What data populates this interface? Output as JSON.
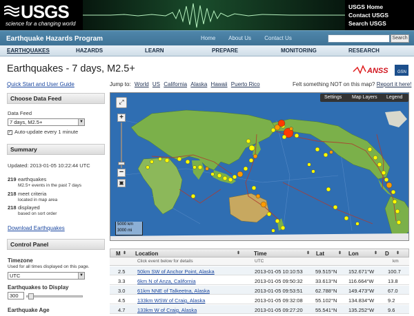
{
  "header": {
    "logo_text": "USGS",
    "logo_tagline": "science for a changing world",
    "links": [
      "USGS Home",
      "Contact USGS",
      "Search USGS"
    ]
  },
  "subheader": {
    "program": "Earthquake Hazards Program",
    "links": [
      "Home",
      "About Us",
      "Contact Us"
    ],
    "search_button": "Search"
  },
  "nav": [
    "EARTHQUAKES",
    "HAZARDS",
    "LEARN",
    "PREPARE",
    "MONITORING",
    "RESEARCH"
  ],
  "page": {
    "title": "Earthquakes - 7 days, M2.5+",
    "anss_logo": "ANSS",
    "anss_sublabel": "GSN"
  },
  "sidebar": {
    "quickstart": "Quick Start and User Guide",
    "choose_feed": {
      "heading": "Choose Data Feed",
      "label": "Data Feed",
      "selected": "7 days, M2.5+",
      "auto_update": "Auto-update every 1 minute",
      "auto_update_checked": true
    },
    "summary": {
      "heading": "Summary",
      "updated": "Updated: 2013-01-05 10:22:44 UTC",
      "count_earthquakes": "219",
      "earthquakes_label": "earthquakes",
      "earthquakes_desc": "M2.5+ events in the past 7 days",
      "count_meet": "218",
      "meet_label": "meet criteria",
      "meet_desc": "located in map area",
      "count_displayed": "218",
      "displayed_label": "displayed",
      "displayed_desc": "based on sort order",
      "download": "Download Earthquakes"
    },
    "control": {
      "heading": "Control Panel",
      "timezone_label": "Timezone",
      "timezone_desc": "Used for all times displayed on this page.",
      "timezone_selected": "UTC",
      "display_label": "Earthquakes to Display",
      "display_value": "300",
      "age_label": "Earthquake Age"
    }
  },
  "jump": {
    "label": "Jump to:",
    "links": [
      "World",
      "US",
      "California",
      "Alaska",
      "Hawaii",
      "Puerto Rico"
    ]
  },
  "felt": {
    "text": "Felt something NOT on this map?",
    "link": "Report it here!"
  },
  "map": {
    "controls": [
      "Settings",
      "Map Layers",
      "Legend"
    ],
    "scale_km": "5000 km",
    "scale_mi": "3000 mi",
    "colors": {
      "ocean": "#2f6eb2",
      "land": "#7bb04a",
      "quake_recent": "#ff3b00",
      "quake_day": "#ff9a00",
      "quake_week": "#ffff00"
    }
  },
  "table": {
    "columns": [
      "M",
      "Location",
      "Time",
      "Lat",
      "Lon",
      "D"
    ],
    "subheaders": [
      "Click event below for details",
      "UTC",
      "",
      "",
      "km"
    ],
    "rows": [
      {
        "m": "2.5",
        "location": "50km SW of Anchor Point, Alaska",
        "time": "2013-01-05 10:10:53",
        "lat": "59.515°N",
        "lon": "152.671°W",
        "depth": "100.7"
      },
      {
        "m": "3.3",
        "location": "6km N of Anza, California",
        "time": "2013-01-05 09:50:32",
        "lat": "33.613°N",
        "lon": "116.664°W",
        "depth": "13.8"
      },
      {
        "m": "3.0",
        "location": "61km NNE of Talkeetna, Alaska",
        "time": "2013-01-05 09:53:51",
        "lat": "62.788°N",
        "lon": "149.473°W",
        "depth": "67.0"
      },
      {
        "m": "4.5",
        "location": "133km WSW of Craig, Alaska",
        "time": "2013-01-05 09:32:08",
        "lat": "55.102°N",
        "lon": "134.834°W",
        "depth": "9.2"
      },
      {
        "m": "4.7",
        "location": "133km W of Craig, Alaska",
        "time": "2013-01-05 09:27:20",
        "lat": "55.541°N",
        "lon": "135.252°W",
        "depth": "9.6"
      }
    ]
  }
}
